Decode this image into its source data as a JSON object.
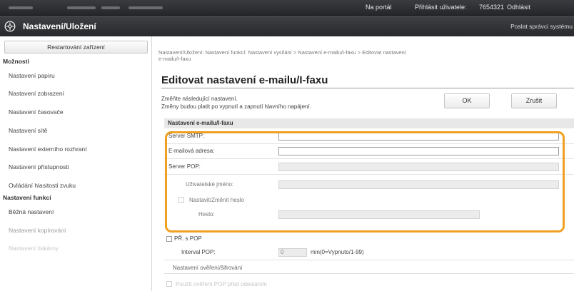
{
  "topbar": {
    "portal_link": "Na portál",
    "login_label": "Přihlásit uživatele:",
    "user_id": "7654321",
    "logout": "Odhlásit"
  },
  "titlebar": {
    "title": "Nastavení/Uložení",
    "mail_link": "Poslat správci systému",
    "logo_icon": "gear-logo-icon"
  },
  "sidebar": {
    "restart_button": "Restartování zařízení",
    "preferences_heading": "Možnosti",
    "preferences_items": [
      "Nastavení papíru",
      "Nastavení zobrazení",
      "Nastavení časovače",
      "Nastavení sítě",
      "Nastavení externího rozhraní",
      "Nastavení přístupnosti",
      "Ovládání hlasitosti zvuku"
    ],
    "function_heading": "Nastavení funkcí",
    "function_items": [
      "Běžná nastavení",
      "Nastavení kopírování",
      "Nastavení tiskárny"
    ]
  },
  "main": {
    "breadcrumb_line1": "Nastavení/Uložení: Nastavení funkcí: Nastavení vysílání > Nastavení e-mailu/I-faxu > Editovat nastavení",
    "breadcrumb_line2": "e-mailu/I-faxu",
    "page_title": "Editovat nastavení e-mailu/I-faxu",
    "desc_line1": "Změňte následující nastavení.",
    "desc_line2": "Změny budou platit po vypnutí a zapnutí hlavního napájení.",
    "ok_button": "OK",
    "cancel_button": "Zrušit",
    "section_heading": "Nastavení e-mailu/I-faxu",
    "smtp_label": "Server SMTP:",
    "smtp_value": "",
    "email_label": "E-mailová adresa:",
    "email_value": "",
    "pop_label": "Server POP:",
    "pop_value": "",
    "username_label": "Uživatelské jméno:",
    "username_value": "",
    "set_password_label": "Nastavit/Změnit heslo",
    "password_label": "Heslo:",
    "password_value": "",
    "rx_pop_label": "PŘ. s POP",
    "pop_interval_label": "Interval POP:",
    "pop_interval_value": "0",
    "pop_interval_unit": "min(0=Vypnuto/1-99)",
    "auth_section_heading": "Nastavení ověření/šifrování",
    "pop_auth_label": "Použít ověření POP před odesláním"
  },
  "colors": {
    "highlight": "#f0a020",
    "topbar": "#2b2d30"
  }
}
